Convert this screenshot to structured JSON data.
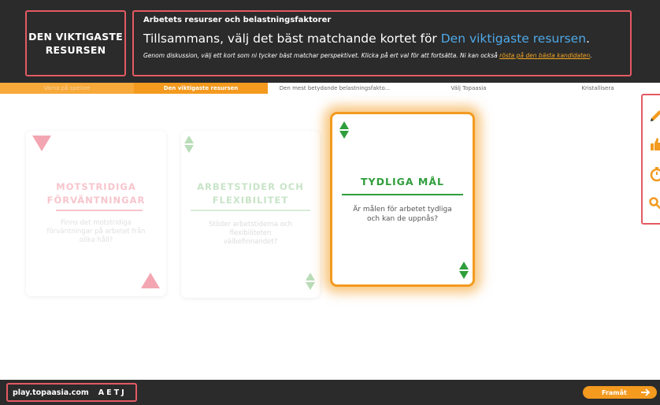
{
  "header": {
    "phase_label": "DEN VIKTIGASTE RESURSEN",
    "section_title": "Arbetets resurser och belastningsfaktorer",
    "headline_prefix": "Tillsammans, välj det bäst matchande kortet för ",
    "headline_highlight": "Den viktigaste resursen",
    "headline_suffix": ".",
    "instruction_text": "Genom diskussion, välj ett kort som ni tycker bäst matchar perspektivet. Klicka på ert val för att fortsätta. Ni kan också ",
    "instruction_link": "rösta på den bästa kandidaten",
    "instruction_end": "."
  },
  "tabs": [
    {
      "label": "Värna på spelare",
      "state": "done"
    },
    {
      "label": "Den viktigaste resursen",
      "state": "active"
    },
    {
      "label": "Den mest betydande belastningsfakto...",
      "state": "todo"
    },
    {
      "label": "Välj Topaasia",
      "state": "todo"
    },
    {
      "label": "Kristallisera",
      "state": "todo"
    }
  ],
  "toolbar": {
    "icons": [
      "pencil-icon",
      "thumbs-up-icon",
      "timer-icon",
      "key-icon"
    ]
  },
  "cards": [
    {
      "title": "MOTSTRIDIGA FÖRVÄNTNINGAR",
      "description": "Finns det motstridiga förväntningar på arbetet från olika håll?",
      "category": "belastningsfaktor",
      "color": "#f7c5cc",
      "selected": false
    },
    {
      "title": "ARBETSTIDER OCH FLEXIBILITET",
      "description": "Stöder arbetstiderna och flexibiliteten välbefinnandet?",
      "category": "resurs",
      "color": "#c8e4c8",
      "selected": false
    },
    {
      "title": "TYDLIGA MÅL",
      "description": "Är målen för arbetet tydliga och kan de uppnås?",
      "category": "resurs",
      "color": "#2f9e3c",
      "selected": true
    }
  ],
  "footer": {
    "url": "play.topaasia.com",
    "game_code": "AETJ",
    "forward_label": "Framåt",
    "forward_icon": "arrow-right-icon"
  },
  "colors": {
    "accent": "#f39a1f",
    "dark_bar": "#2b2b2b",
    "highlight_blue": "#4fa9e8",
    "annotation_red": "#e45a63"
  }
}
